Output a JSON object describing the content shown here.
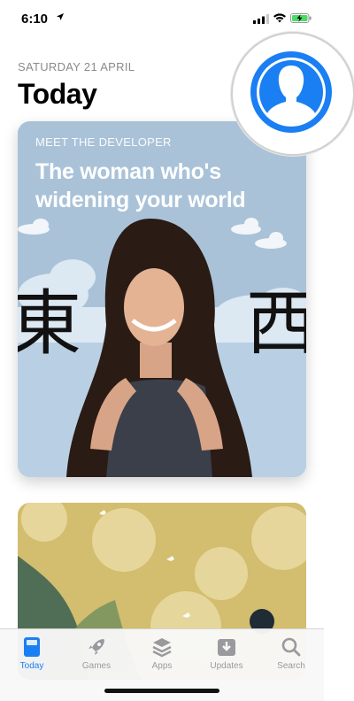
{
  "status_bar": {
    "time": "6:10"
  },
  "header": {
    "date": "SATURDAY 21 APRIL",
    "title": "Today"
  },
  "cards": [
    {
      "eyebrow": "MEET THE DEVELOPER",
      "headline": "The woman who's widening your world",
      "glyph_left": "東",
      "glyph_right": "西"
    }
  ],
  "tabs": [
    {
      "label": "Today",
      "icon": "today-icon",
      "active": true
    },
    {
      "label": "Games",
      "icon": "rocket-icon"
    },
    {
      "label": "Apps",
      "icon": "layers-icon"
    },
    {
      "label": "Updates",
      "icon": "download-tray-icon"
    },
    {
      "label": "Search",
      "icon": "magnifier-icon"
    }
  ],
  "colors": {
    "accent": "#1a7ff2",
    "inactive": "#9a9a9e",
    "card1_bg": "#a9c2d8",
    "card2_bg": "#d3bd6e"
  }
}
